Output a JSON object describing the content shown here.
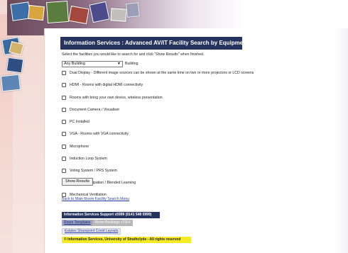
{
  "page": {
    "title": "Information Services : Advanced AV/IT Facility Search by Equipment",
    "instructions": "Select the facilities you would like to search for and click \"Show Results\" when finished."
  },
  "search": {
    "building_select_value": "Any Building",
    "building_label": "Building"
  },
  "facilities": [
    {
      "label": "Dual Display - Different image sources can be shown at the same time on two or more projectors or LCD screens",
      "checked": false
    },
    {
      "label": "HDMI - Rooms with digital HDMI connectivity",
      "checked": false
    },
    {
      "label": "Rooms with bring your own device, wireless presentation",
      "checked": false
    },
    {
      "label": "Document Camera / Visualiser",
      "checked": false
    },
    {
      "label": "PC Installed",
      "checked": false
    },
    {
      "label": "VGA - Rooms with VGA connectivity",
      "checked": false
    },
    {
      "label": "Microphone",
      "checked": false
    },
    {
      "label": "Induction Loop System",
      "checked": false
    },
    {
      "label": "Voting System / PRS System",
      "checked": false
    },
    {
      "label": "Remote Participation / Blended Learning",
      "checked": false
    },
    {
      "label": "Mechanical Ventilation",
      "checked": false
    }
  ],
  "actions": {
    "show_results": "Show Results",
    "back_link": "Back to Main Room Facility Search Menu"
  },
  "footer": {
    "support": "Information Services Support x5999 (0141 548 5999)",
    "room_templates": "Room Templates",
    "room_bookings": "Room Bookings",
    "room_bookings_ext": "x2964",
    "estates_link": "Estates Sharepoint Covid Layouts",
    "copyright": "© Information Services, University of Strathclyde - All rights reserved"
  },
  "colors": {
    "title_bg": "#26335f",
    "link": "#2a3fa6",
    "copyright_bg": "#f6ea26",
    "page_bg": "#f6e3df"
  }
}
